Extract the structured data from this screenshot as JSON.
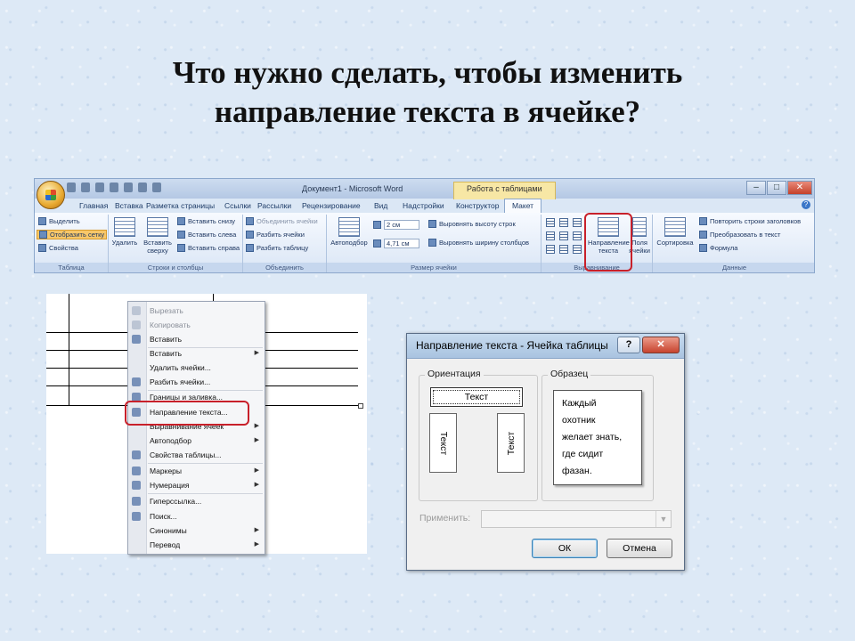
{
  "slide": {
    "title_line1": "Что нужно сделать, чтобы изменить",
    "title_line2": "направление текста в ячейке?"
  },
  "ribbon": {
    "window_title": "Документ1 - Microsoft Word",
    "context_tab_title": "Работа с таблицами",
    "window_controls": [
      "–",
      "□",
      "✕"
    ],
    "help_icon": "?",
    "tabs": [
      "Главная",
      "Вставка",
      "Разметка страницы",
      "Ссылки",
      "Рассылки",
      "Рецензирование",
      "Вид",
      "Надстройки",
      "Конструктор",
      "Макет"
    ],
    "active_tab": "Макет",
    "groups": {
      "table": {
        "name": "Таблица",
        "items": [
          "Выделить",
          "Отобразить сетку",
          "Свойства"
        ]
      },
      "rows_cols": {
        "name": "Строки и столбцы",
        "delete_label_1": "Удалить",
        "insert_above_1": "Вставить",
        "insert_above_2": "сверху",
        "items": [
          "Вставить снизу",
          "Вставить слева",
          "Вставить справа"
        ]
      },
      "merge": {
        "name": "Объединить",
        "items": [
          "Объединить ячейки",
          "Разбить ячейки",
          "Разбить таблицу"
        ]
      },
      "cell_size": {
        "name": "Размер ячейки",
        "autofit": "Автоподбор",
        "height_value": "2 см",
        "width_value": "4,71 см",
        "items": [
          "Выровнять высоту строк",
          "Выровнять ширину столбцов"
        ]
      },
      "alignment": {
        "name": "Выравнивание",
        "text_direction_1": "Направление",
        "text_direction_2": "текста",
        "margins_1": "Поля",
        "margins_2": "ячейки"
      },
      "data": {
        "name": "Данные",
        "sort": "Сортировка",
        "items": [
          "Повторить строки заголовков",
          "Преобразовать в текст",
          "Формула"
        ]
      }
    }
  },
  "context_menu": {
    "items": [
      {
        "label": "Вырезать",
        "disabled": true,
        "submenu": false
      },
      {
        "label": "Копировать",
        "disabled": true,
        "submenu": false
      },
      {
        "label": "Вставить",
        "disabled": false,
        "submenu": false
      },
      {
        "label": "Вставить",
        "disabled": false,
        "submenu": true
      },
      {
        "label": "Удалить ячейки...",
        "disabled": false,
        "submenu": false
      },
      {
        "label": "Разбить ячейки...",
        "disabled": false,
        "submenu": false
      },
      {
        "label": "Границы и заливка...",
        "disabled": false,
        "submenu": false
      },
      {
        "label": "Направление текста...",
        "disabled": false,
        "submenu": false
      },
      {
        "label": "Выравнивание ячеек",
        "disabled": false,
        "submenu": true
      },
      {
        "label": "Автоподбор",
        "disabled": false,
        "submenu": true
      },
      {
        "label": "Свойства таблицы...",
        "disabled": false,
        "submenu": false
      },
      {
        "label": "Маркеры",
        "disabled": false,
        "submenu": true
      },
      {
        "label": "Нумерация",
        "disabled": false,
        "submenu": true
      },
      {
        "label": "Гиперссылка...",
        "disabled": false,
        "submenu": false
      },
      {
        "label": "Поиск...",
        "disabled": false,
        "submenu": false
      },
      {
        "label": "Синонимы",
        "disabled": false,
        "submenu": true
      },
      {
        "label": "Перевод",
        "disabled": false,
        "submenu": true
      }
    ],
    "highlighted": "Направление текста..."
  },
  "dialog": {
    "title": "Направление текста - Ячейка таблицы",
    "help_label": "?",
    "close_label": "✕",
    "orientation_legend": "Ориентация",
    "orientation_options": [
      "Текст",
      "Текст",
      "Текст"
    ],
    "selected_orientation": "horizontal",
    "sample_legend": "Образец",
    "sample_lines": [
      "Каждый",
      "охотник",
      "желает знать,",
      "где сидит",
      "фазан."
    ],
    "apply_label": "Применить:",
    "apply_value": "",
    "ok_label": "ОК",
    "cancel_label": "Отмена"
  },
  "colors": {
    "highlight_ring": "#c8202a",
    "slide_background": "#dde9f6"
  }
}
